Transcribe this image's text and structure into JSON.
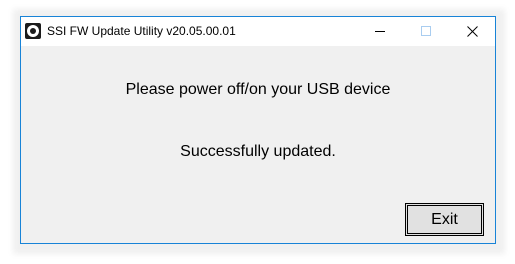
{
  "window": {
    "title": "SSI FW Update Utility v20.05.00.01",
    "icon": "app-icon",
    "accent_border_color": "#1883d7",
    "client_background": "#f0f0f0"
  },
  "caption_buttons": {
    "minimize": "minimize-icon",
    "maximize": "maximize-icon",
    "close": "close-icon"
  },
  "messages": {
    "instruction": "Please power off/on your USB device",
    "status": "Successfully updated."
  },
  "actions": {
    "exit_label": "Exit"
  }
}
